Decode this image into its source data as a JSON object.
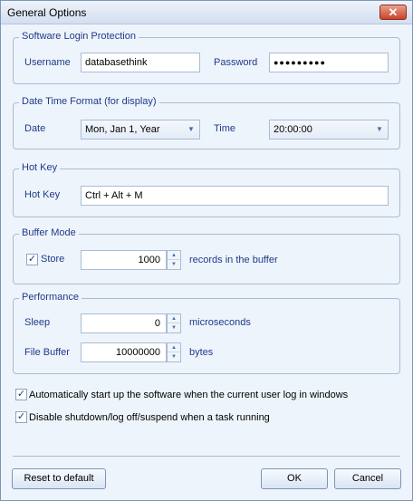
{
  "window": {
    "title": "General Options",
    "close_glyph": "✕"
  },
  "login": {
    "legend": "Software Login Protection",
    "username_label": "Username",
    "username_value": "databasethink",
    "password_label": "Password",
    "password_value": "●●●●●●●●●"
  },
  "datetime": {
    "legend": "Date Time Format (for display)",
    "date_label": "Date",
    "date_value": "Mon, Jan 1, Year",
    "time_label": "Time",
    "time_value": "20:00:00"
  },
  "hotkey": {
    "legend": "Hot Key",
    "label": "Hot Key",
    "value": "Ctrl + Alt + M"
  },
  "buffer": {
    "legend": "Buffer Mode",
    "store_label": "Store",
    "store_checked": true,
    "value": "1000",
    "suffix": "records in the buffer"
  },
  "performance": {
    "legend": "Performance",
    "sleep_label": "Sleep",
    "sleep_value": "0",
    "sleep_unit": "microseconds",
    "filebuffer_label": "File Buffer",
    "filebuffer_value": "10000000",
    "filebuffer_unit": "bytes"
  },
  "options": {
    "autostart_label": "Automatically start up the software when the current user log in windows",
    "autostart_checked": true,
    "disable_label": "Disable shutdown/log off/suspend when a task running",
    "disable_checked": true
  },
  "buttons": {
    "reset": "Reset to default",
    "ok": "OK",
    "cancel": "Cancel"
  },
  "icons": {
    "check": "check-icon",
    "close": "close-icon",
    "arrow": "chevron-down-icon"
  },
  "colors": {
    "label": "#1e3a8a",
    "border": "#a9bcd6",
    "background": "#eef4fb"
  }
}
